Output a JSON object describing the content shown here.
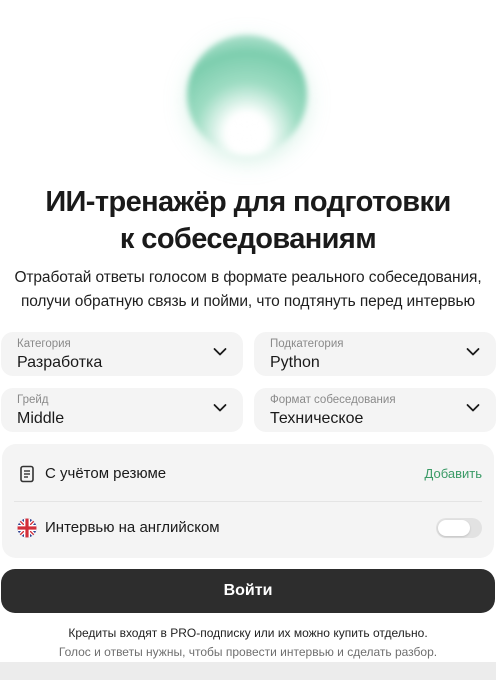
{
  "hero": {
    "title_line1": "ИИ-тренажёр для подготовки",
    "title_line2": "к собеседованиям",
    "subtitle_line1": "Отработай ответы голосом в формате реального собеседования,",
    "subtitle_line2": "получи обратную связь и пойми, что подтянуть перед интервью"
  },
  "selects": {
    "category": {
      "label": "Категория",
      "value": "Разработка"
    },
    "subcategory": {
      "label": "Подкатегория",
      "value": "Python"
    },
    "grade": {
      "label": "Грейд",
      "value": "Middle"
    },
    "format": {
      "label": "Формат собеседования",
      "value": "Техническое"
    }
  },
  "options": {
    "resume": {
      "label": "С учётом резюме",
      "action": "Добавить",
      "icon": "document-icon"
    },
    "english": {
      "label": "Интервью на английском",
      "icon": "uk-flag-icon",
      "enabled": false
    }
  },
  "login_button": "Войти",
  "footer": {
    "note1": "Кредиты входят в PRO-подписку или их можно купить отдельно.",
    "note2": "Голос и ответы нужны, чтобы провести интервью и сделать разбор."
  },
  "colors": {
    "accent": "#3a9a66",
    "button": "#2d2d2d",
    "field_bg": "#f4f4f4",
    "orb": "#8cd6b8"
  }
}
